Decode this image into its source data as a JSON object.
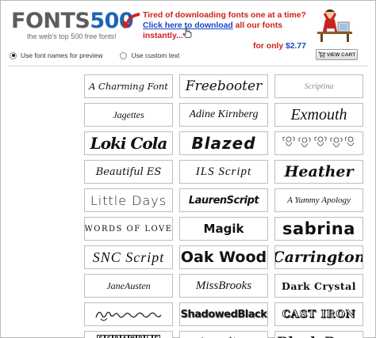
{
  "header": {
    "logo_part1": "FONTS",
    "logo_part2": "500",
    "tagline": "the web's top 500 free fonts!",
    "promo_line1": "Tired of downloading fonts one at a time?",
    "promo_link": "Click here to download",
    "promo_line2_rest": " all our fonts instantly...",
    "price_label": "for only ",
    "price": "$2.77"
  },
  "options": {
    "radio1_label": "Use font names for preview",
    "radio1_selected": true,
    "radio2_label": "Use custom text",
    "radio2_selected": false,
    "view_cart_label": "VIEW CART"
  },
  "fonts": [
    {
      "text": "A Charming Font",
      "style": "s-charming"
    },
    {
      "text": "Freebooter",
      "style": "s-freebooter"
    },
    {
      "text": "Scriptina",
      "style": "s-scriptina"
    },
    {
      "text": "Jagettes",
      "style": "s-jagettes"
    },
    {
      "text": "Adine Kirnberg",
      "style": "s-adine"
    },
    {
      "text": "Exmouth",
      "style": "s-exmouth"
    },
    {
      "text": "Loki Cola",
      "style": "s-loki"
    },
    {
      "text": "Blazed",
      "style": "s-blazed"
    },
    {
      "text": "",
      "style": "s-dingbat"
    },
    {
      "text": "Beautiful ES",
      "style": "s-beautiful"
    },
    {
      "text": "ILS Script",
      "style": "s-ils"
    },
    {
      "text": "Heather",
      "style": "s-heather"
    },
    {
      "text": "Little Days",
      "style": "s-little"
    },
    {
      "text": "LaurenScript",
      "style": "s-lauren"
    },
    {
      "text": "A Yummy Apology",
      "style": "s-yummy"
    },
    {
      "text": "WORDS OF LOVE",
      "style": "s-words"
    },
    {
      "text": "Magik",
      "style": "s-magik"
    },
    {
      "text": "sabrina",
      "style": "s-sabrina"
    },
    {
      "text": "SNC Script",
      "style": "s-snc"
    },
    {
      "text": "Oak Wood",
      "style": "s-oak"
    },
    {
      "text": "Carrington",
      "style": "s-carrington"
    },
    {
      "text": "JaneAusten",
      "style": "s-jane"
    },
    {
      "text": "MissBrooks",
      "style": "s-miss"
    },
    {
      "text": "Dark Crystal",
      "style": "s-dark"
    },
    {
      "text": "",
      "style": "s-scrib"
    },
    {
      "text": "ShadowedBlack",
      "style": "s-shadowed"
    },
    {
      "text": "CAST IRON",
      "style": "s-cast"
    },
    {
      "text": "SCRAMBLE",
      "style": "s-scramble"
    },
    {
      "text": "Angelina",
      "style": "s-angelina"
    },
    {
      "text": "Black Rose",
      "style": "s-black"
    }
  ],
  "colors": {
    "logo_gray": "#5d5d5d",
    "logo_blue": "#1f63b5",
    "promo_red": "#d0201a",
    "promo_blue": "#1a46c8"
  }
}
